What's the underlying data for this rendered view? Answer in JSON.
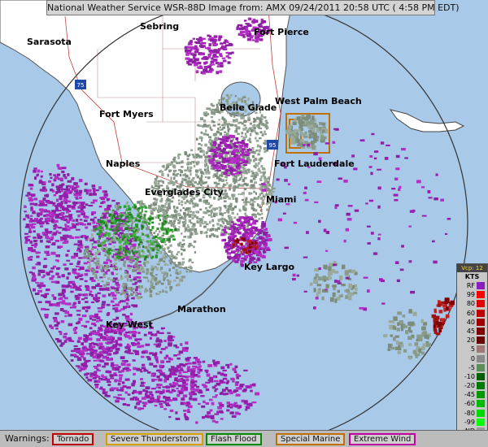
{
  "header": {
    "title": "National Weather Service WSR-88D Image from:  AMX 09/24/2011  20:58 UTC ( 4:58 PM EDT)"
  },
  "cities": [
    {
      "id": "sarasota",
      "name": "Sarasota"
    },
    {
      "id": "sebring",
      "name": "Sebring"
    },
    {
      "id": "fort-pierce",
      "name": "Fort Pierce"
    },
    {
      "id": "west-palm-beach",
      "name": "West Palm Beach"
    },
    {
      "id": "belle-glade",
      "name": "Belle Glade"
    },
    {
      "id": "fort-myers",
      "name": "Fort Myers"
    },
    {
      "id": "naples",
      "name": "Naples"
    },
    {
      "id": "fort-lauderdale",
      "name": "Fort Lauderdale"
    },
    {
      "id": "everglades-city",
      "name": "Everglades City"
    },
    {
      "id": "miami",
      "name": "Miami"
    },
    {
      "id": "key-largo",
      "name": "Key Largo"
    },
    {
      "id": "marathon",
      "name": "Marathon"
    },
    {
      "id": "key-west",
      "name": "Key West"
    }
  ],
  "highways": [
    {
      "id": "i75",
      "label": "75"
    },
    {
      "id": "i95",
      "label": "95"
    }
  ],
  "scale": {
    "header": "Vcp: 12",
    "unit": "KTS",
    "entries": [
      {
        "label": "RF",
        "color": "#8a1fbf"
      },
      {
        "label": "99",
        "color": "#ff0000"
      },
      {
        "label": "80",
        "color": "#e00000"
      },
      {
        "label": "60",
        "color": "#c00000"
      },
      {
        "label": "40",
        "color": "#a00000"
      },
      {
        "label": "45",
        "color": "#800000"
      },
      {
        "label": "20",
        "color": "#6a0000"
      },
      {
        "label": "5",
        "color": "#a07878"
      },
      {
        "label": "0",
        "color": "#8a8a8a"
      },
      {
        "label": "-5",
        "color": "#5a8f5a"
      },
      {
        "label": "-10",
        "color": "#006000"
      },
      {
        "label": "-20",
        "color": "#007a00"
      },
      {
        "label": "-45",
        "color": "#009a00"
      },
      {
        "label": "-60",
        "color": "#00ba00"
      },
      {
        "label": "-80",
        "color": "#00d800"
      },
      {
        "label": "-99",
        "color": "#00ff00"
      },
      {
        "label": "ND",
        "color": "#9a9a9a"
      }
    ]
  },
  "warnings": {
    "title": "Warnings:",
    "items": [
      {
        "label": "Tornado",
        "color": "#c00000"
      },
      {
        "label": "Severe Thunderstorm",
        "color": "#d4a000"
      },
      {
        "label": "Flash Flood",
        "color": "#008a00"
      },
      {
        "label": "Special Marine",
        "color": "#c07000"
      },
      {
        "label": "Extreme Wind",
        "color": "#c000a0"
      }
    ]
  }
}
